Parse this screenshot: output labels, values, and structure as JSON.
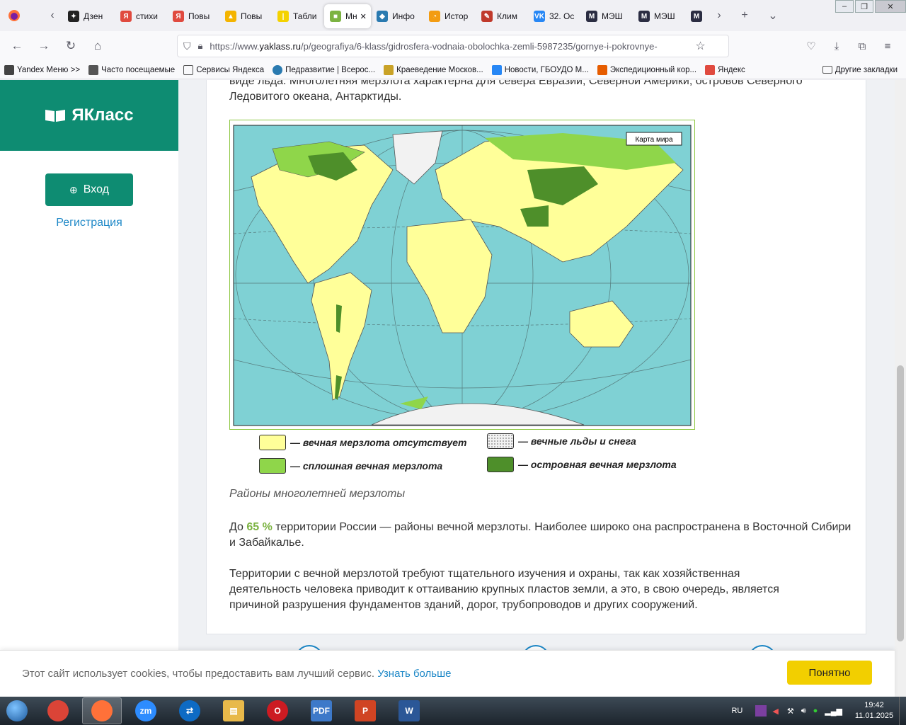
{
  "browser": {
    "tabs": [
      {
        "label": "Дзен",
        "color": "#222222",
        "glyph": "✦"
      },
      {
        "label": "стихи",
        "color": "#e04a3f",
        "glyph": "Я"
      },
      {
        "label": "Повы",
        "color": "#e04a3f",
        "glyph": "Я"
      },
      {
        "label": "Повы",
        "color": "#f4b400",
        "glyph": "▲"
      },
      {
        "label": "Табли",
        "color": "#f4d200",
        "glyph": "|"
      },
      {
        "label": "Мн",
        "color": "#7cb342",
        "glyph": "■",
        "active": true
      },
      {
        "label": "Инфо",
        "color": "#2a7ab0",
        "glyph": "◆"
      },
      {
        "label": "Истор",
        "color": "#f39c12",
        "glyph": "◔"
      },
      {
        "label": "Клим",
        "color": "#c0392b",
        "glyph": "✎"
      },
      {
        "label": "32. Ос",
        "color": "#2787f5",
        "glyph": "VK"
      },
      {
        "label": "МЭШ",
        "color": "#2b2d42",
        "glyph": "M"
      },
      {
        "label": "МЭШ",
        "color": "#2b2d42",
        "glyph": "M"
      },
      {
        "label": "",
        "color": "#2b2d42",
        "glyph": "M"
      }
    ],
    "url_prefix": "https://www.",
    "url_domain": "yaklass.ru",
    "url_rest": "/p/geografiya/6-klass/gidrosfera-vodnaia-obolochka-zemli-5987235/gornye-i-pokrovnye-",
    "bookmarks": [
      {
        "label": "Yandex Меню >>",
        "icon": "search-icon"
      },
      {
        "label": "Часто посещаемые",
        "icon": "gear-icon"
      },
      {
        "label": "Сервисы Яндекса",
        "icon": "folder-icon"
      },
      {
        "label": "Педразвитие | Всерос...",
        "icon": "globe-icon"
      },
      {
        "label": "Краеведение Москов...",
        "icon": "shield-icon"
      },
      {
        "label": "Новости, ГБОУДО М...",
        "icon": "badge-icon"
      },
      {
        "label": "Экспедиционный кор...",
        "icon": "flame-icon"
      },
      {
        "label": "Яндекс",
        "icon": "yandex-icon"
      }
    ],
    "other_bookmarks": "Другие закладки"
  },
  "sidebar": {
    "logo": "ЯКласс",
    "login_button": "Вход",
    "register_link": "Регистрация"
  },
  "article": {
    "intro": "виде льда. Многолетняя мерзлота характерна для севера Евразии, Северной Америки, островов Северного Ледовитого океана, Антарктиды.",
    "map_label": "Карта мира",
    "legend": [
      {
        "label": "— вечная мерзлота отсутствует",
        "color": "#ffff99"
      },
      {
        "label": "— вечные льды и снега",
        "color": "#f2f2f2"
      },
      {
        "label": "— сплошная вечная мерзлота",
        "color": "#8fd64a"
      },
      {
        "label": "— островная вечная мерзлота",
        "color": "#4e8f2a"
      }
    ],
    "caption": "Районы многолетней мерзлоты",
    "p2_before": "До ",
    "p2_highlight": "65 %",
    "p2_after": " территории России — районы вечной мерзлоты. Наиболее широко она распространена в Восточной Сибири и Забайкалье.",
    "p3": "Территории с вечной мерзлотой требуют тщательного изучения и охраны, так как хозяйственная деятельность человека приводит к оттаиванию крупных пластов земли, а это, в свою очередь, является причиной разрушения фундаментов зданий, дорог, трубопроводов и других сооружений."
  },
  "cookie": {
    "text": "Этот сайт использует cookies, чтобы предоставить вам лучший сервис. ",
    "link": "Узнать больше",
    "button": "Понятно"
  },
  "taskbar": {
    "apps": [
      {
        "name": "chrome-icon",
        "color": "#db4437",
        "glyph": ""
      },
      {
        "name": "firefox-icon",
        "color": "#ff7139",
        "glyph": "",
        "active": true
      },
      {
        "name": "zoom-icon",
        "color": "#2d8cff",
        "glyph": "zm"
      },
      {
        "name": "teamviewer-icon",
        "color": "#0e6bc4",
        "glyph": "⇄"
      },
      {
        "name": "explorer-icon",
        "color": "#e8b94a",
        "glyph": "▤"
      },
      {
        "name": "opera-icon",
        "color": "#cc1b22",
        "glyph": "O"
      },
      {
        "name": "pdf-icon",
        "color": "#3d79c9",
        "glyph": "PDF"
      },
      {
        "name": "powerpoint-icon",
        "color": "#d04423",
        "glyph": "P"
      },
      {
        "name": "word-icon",
        "color": "#2b5797",
        "glyph": "W"
      }
    ],
    "language": "RU",
    "time": "19:42",
    "date": "11.01.2025"
  }
}
